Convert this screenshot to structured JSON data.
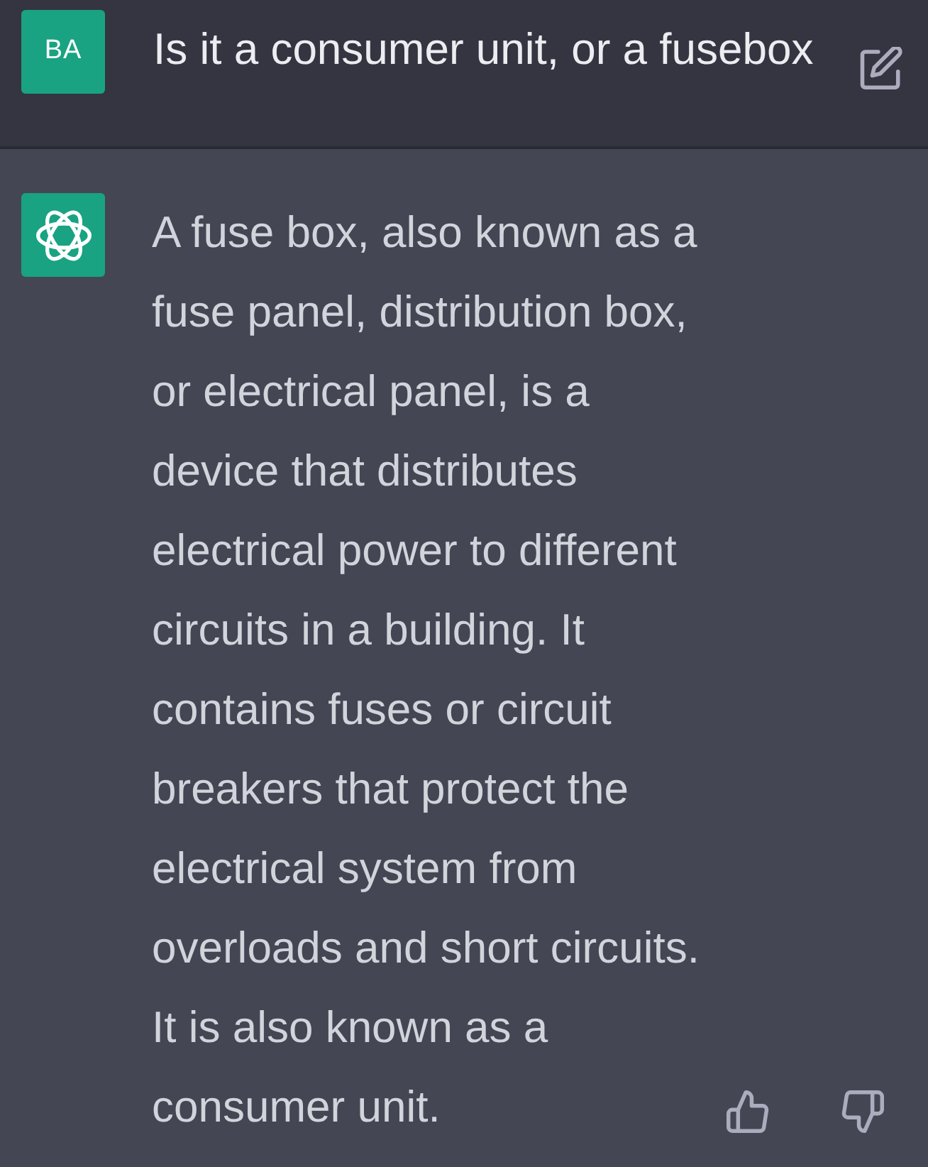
{
  "user_message": {
    "avatar": "BA",
    "text": "Is it a consumer unit, or a fusebox"
  },
  "assistant_message": {
    "text": "A fuse box, also known as a\nfuse panel, distribution box,\nor electrical panel, is a\ndevice that distributes\nelectrical power to different\ncircuits in a building. It\ncontains fuses or circuit\nbreakers that protect the\nelectrical system from\noverloads and short circuits.\nIt is also known as a\nconsumer unit."
  }
}
